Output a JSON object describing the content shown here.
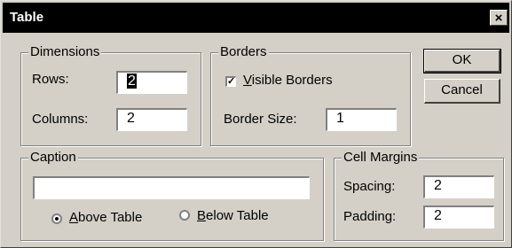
{
  "window": {
    "title": "Table",
    "close_glyph": "×"
  },
  "dimensions": {
    "legend": "Dimensions",
    "rows_label": "Rows:",
    "rows_value": "2",
    "columns_label": "Columns:",
    "columns_value": "2"
  },
  "borders": {
    "legend": "Borders",
    "visible_label_accel": "V",
    "visible_label_rest": "isible Borders",
    "visible_checked": true,
    "border_size_label": "Border Size:",
    "border_size_value": "1"
  },
  "buttons": {
    "ok_label": "OK",
    "cancel_label": "Cancel"
  },
  "caption": {
    "legend": "Caption",
    "value": "",
    "above_accel": "A",
    "above_rest": "bove Table",
    "below_accel": "B",
    "below_rest": "elow Table",
    "selected": "above"
  },
  "cell_margins": {
    "legend": "Cell Margins",
    "spacing_label": "Spacing:",
    "spacing_value": "2",
    "padding_label": "Padding:",
    "padding_value": "2"
  },
  "colors": {
    "title_bar": "#000000",
    "face": "#d4d0c8"
  }
}
